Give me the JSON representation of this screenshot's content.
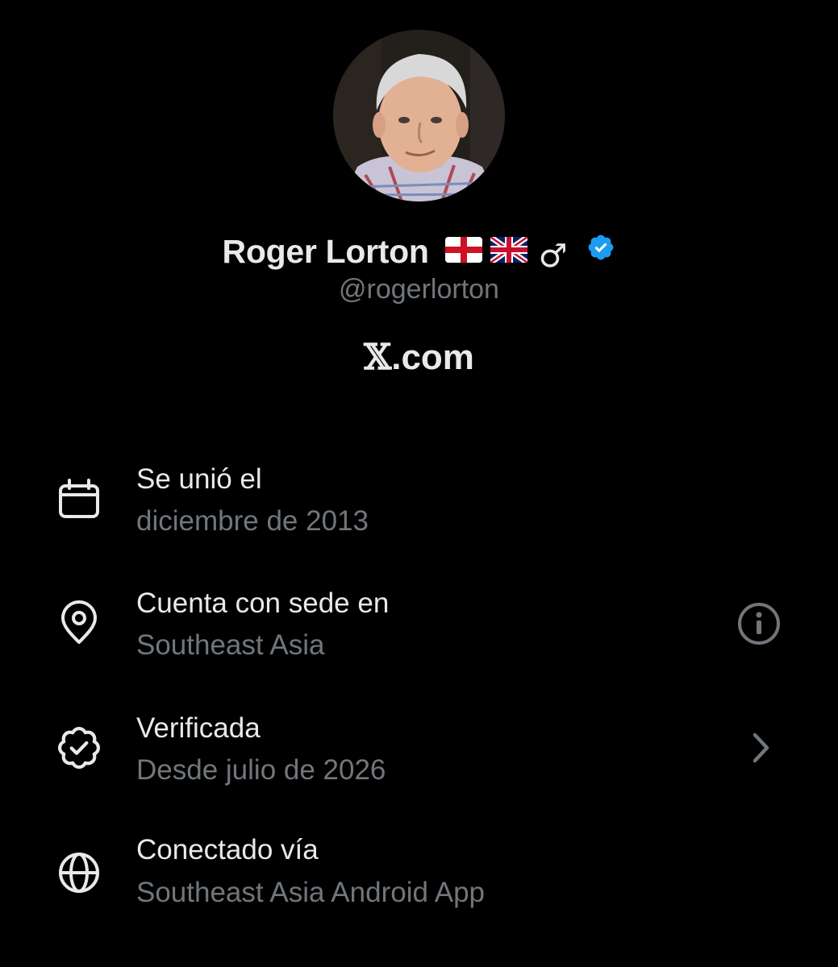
{
  "profile": {
    "display_name": "Roger Lorton",
    "handle": "@rogerlorton",
    "site": ".com",
    "site_glyph": "𝕏",
    "male_symbol": "♂",
    "flags": [
      "england-flag",
      "uk-flag"
    ],
    "verified_color": "#1d9bf0"
  },
  "info": {
    "joined": {
      "title": "Se unió el",
      "value": "diciembre de 2013",
      "icon": "calendar-icon"
    },
    "location": {
      "title": "Cuenta con sede en",
      "value": "Southeast Asia",
      "icon": "location-pin-icon",
      "action_icon": "info-icon"
    },
    "verified": {
      "title": "Verificada",
      "value": "Desde julio de 2026",
      "icon": "verified-badge-outline-icon",
      "action_icon": "chevron-right-icon"
    },
    "connected": {
      "title": "Conectado vía",
      "value": "Southeast Asia Android App",
      "icon": "globe-icon"
    }
  },
  "colors": {
    "background": "#000000",
    "primary_text": "#e7e9ea",
    "secondary_text": "#71767b",
    "accent": "#1d9bf0"
  }
}
